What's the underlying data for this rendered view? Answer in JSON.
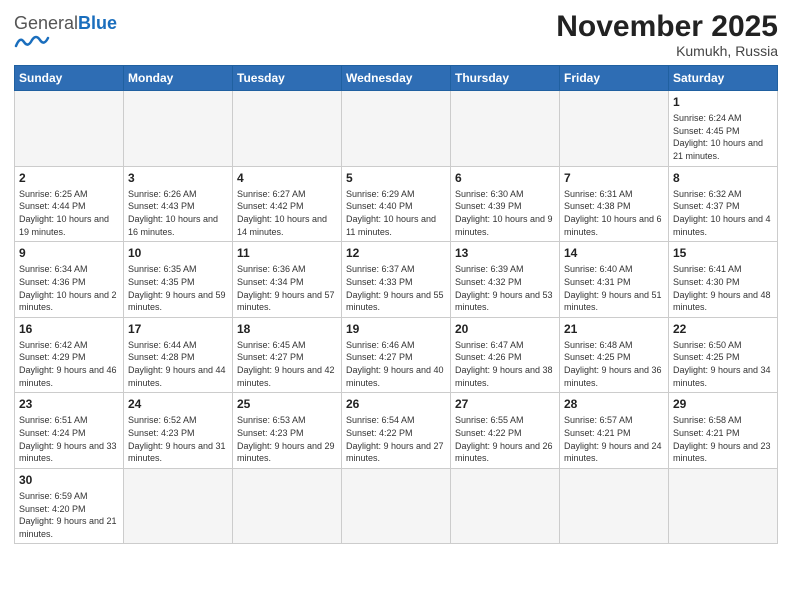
{
  "header": {
    "logo_general": "General",
    "logo_blue": "Blue",
    "month_title": "November 2025",
    "location": "Kumukh, Russia"
  },
  "weekdays": [
    "Sunday",
    "Monday",
    "Tuesday",
    "Wednesday",
    "Thursday",
    "Friday",
    "Saturday"
  ],
  "days": [
    {
      "date": "",
      "info": ""
    },
    {
      "date": "",
      "info": ""
    },
    {
      "date": "",
      "info": ""
    },
    {
      "date": "",
      "info": ""
    },
    {
      "date": "",
      "info": ""
    },
    {
      "date": "",
      "info": ""
    },
    {
      "date": "1",
      "info": "Sunrise: 6:24 AM\nSunset: 4:45 PM\nDaylight: 10 hours and 21 minutes."
    },
    {
      "date": "2",
      "info": "Sunrise: 6:25 AM\nSunset: 4:44 PM\nDaylight: 10 hours and 19 minutes."
    },
    {
      "date": "3",
      "info": "Sunrise: 6:26 AM\nSunset: 4:43 PM\nDaylight: 10 hours and 16 minutes."
    },
    {
      "date": "4",
      "info": "Sunrise: 6:27 AM\nSunset: 4:42 PM\nDaylight: 10 hours and 14 minutes."
    },
    {
      "date": "5",
      "info": "Sunrise: 6:29 AM\nSunset: 4:40 PM\nDaylight: 10 hours and 11 minutes."
    },
    {
      "date": "6",
      "info": "Sunrise: 6:30 AM\nSunset: 4:39 PM\nDaylight: 10 hours and 9 minutes."
    },
    {
      "date": "7",
      "info": "Sunrise: 6:31 AM\nSunset: 4:38 PM\nDaylight: 10 hours and 6 minutes."
    },
    {
      "date": "8",
      "info": "Sunrise: 6:32 AM\nSunset: 4:37 PM\nDaylight: 10 hours and 4 minutes."
    },
    {
      "date": "9",
      "info": "Sunrise: 6:34 AM\nSunset: 4:36 PM\nDaylight: 10 hours and 2 minutes."
    },
    {
      "date": "10",
      "info": "Sunrise: 6:35 AM\nSunset: 4:35 PM\nDaylight: 9 hours and 59 minutes."
    },
    {
      "date": "11",
      "info": "Sunrise: 6:36 AM\nSunset: 4:34 PM\nDaylight: 9 hours and 57 minutes."
    },
    {
      "date": "12",
      "info": "Sunrise: 6:37 AM\nSunset: 4:33 PM\nDaylight: 9 hours and 55 minutes."
    },
    {
      "date": "13",
      "info": "Sunrise: 6:39 AM\nSunset: 4:32 PM\nDaylight: 9 hours and 53 minutes."
    },
    {
      "date": "14",
      "info": "Sunrise: 6:40 AM\nSunset: 4:31 PM\nDaylight: 9 hours and 51 minutes."
    },
    {
      "date": "15",
      "info": "Sunrise: 6:41 AM\nSunset: 4:30 PM\nDaylight: 9 hours and 48 minutes."
    },
    {
      "date": "16",
      "info": "Sunrise: 6:42 AM\nSunset: 4:29 PM\nDaylight: 9 hours and 46 minutes."
    },
    {
      "date": "17",
      "info": "Sunrise: 6:44 AM\nSunset: 4:28 PM\nDaylight: 9 hours and 44 minutes."
    },
    {
      "date": "18",
      "info": "Sunrise: 6:45 AM\nSunset: 4:27 PM\nDaylight: 9 hours and 42 minutes."
    },
    {
      "date": "19",
      "info": "Sunrise: 6:46 AM\nSunset: 4:27 PM\nDaylight: 9 hours and 40 minutes."
    },
    {
      "date": "20",
      "info": "Sunrise: 6:47 AM\nSunset: 4:26 PM\nDaylight: 9 hours and 38 minutes."
    },
    {
      "date": "21",
      "info": "Sunrise: 6:48 AM\nSunset: 4:25 PM\nDaylight: 9 hours and 36 minutes."
    },
    {
      "date": "22",
      "info": "Sunrise: 6:50 AM\nSunset: 4:25 PM\nDaylight: 9 hours and 34 minutes."
    },
    {
      "date": "23",
      "info": "Sunrise: 6:51 AM\nSunset: 4:24 PM\nDaylight: 9 hours and 33 minutes."
    },
    {
      "date": "24",
      "info": "Sunrise: 6:52 AM\nSunset: 4:23 PM\nDaylight: 9 hours and 31 minutes."
    },
    {
      "date": "25",
      "info": "Sunrise: 6:53 AM\nSunset: 4:23 PM\nDaylight: 9 hours and 29 minutes."
    },
    {
      "date": "26",
      "info": "Sunrise: 6:54 AM\nSunset: 4:22 PM\nDaylight: 9 hours and 27 minutes."
    },
    {
      "date": "27",
      "info": "Sunrise: 6:55 AM\nSunset: 4:22 PM\nDaylight: 9 hours and 26 minutes."
    },
    {
      "date": "28",
      "info": "Sunrise: 6:57 AM\nSunset: 4:21 PM\nDaylight: 9 hours and 24 minutes."
    },
    {
      "date": "29",
      "info": "Sunrise: 6:58 AM\nSunset: 4:21 PM\nDaylight: 9 hours and 23 minutes."
    },
    {
      "date": "30",
      "info": "Sunrise: 6:59 AM\nSunset: 4:20 PM\nDaylight: 9 hours and 21 minutes."
    }
  ]
}
